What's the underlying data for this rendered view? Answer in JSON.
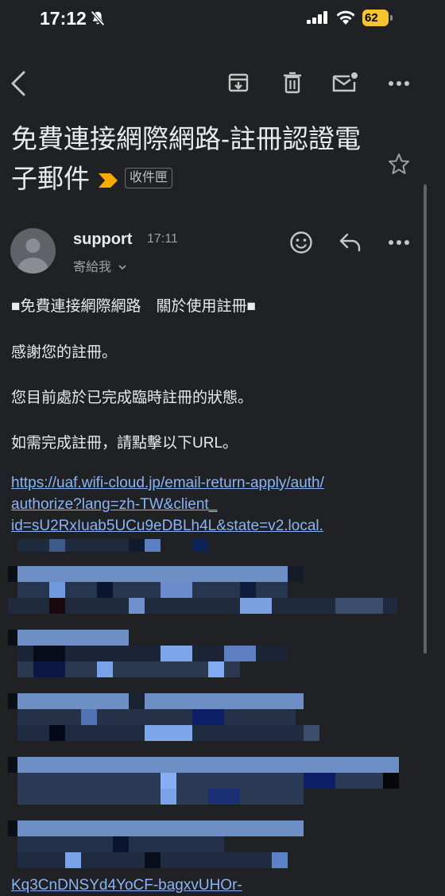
{
  "status_bar": {
    "time": "17:12",
    "battery": "62",
    "icons": [
      "bell-slash-icon",
      "signal-icon",
      "wifi-icon",
      "battery-charging-icon"
    ]
  },
  "toolbar": {
    "icons": [
      "back-icon",
      "archive-icon",
      "trash-icon",
      "mark-unread-icon",
      "more-icon"
    ]
  },
  "email": {
    "subject": "免費連接網際網路-註冊認證電子郵件",
    "label": "收件匣",
    "sender": "support",
    "time": "17:11",
    "to": "寄給我",
    "body": {
      "heading": "■免費連接網際網路　關於使用註冊■",
      "line1": "感謝您的註冊。",
      "line2": "您目前處於已完成臨時註冊的狀態。",
      "line3": "如需完成註冊，請點擊以下URL。",
      "link_line1": "https://uaf.wifi-cloud.jp/email-return-apply/auth/",
      "link_line2": "authorize?lang=zh-TW&client_",
      "link_line3": "id=sU2RxIuab5UCu9eDBLh4L&state=v2.local.",
      "link_last": "Kq3CnDNSYd4YoCF-bagxvUHOr-"
    }
  },
  "colors": {
    "background": "#202124",
    "text": "#e8eaed",
    "link": "#8ab4f8",
    "muted": "#9aa0a6",
    "important_marker": "#f9ab00",
    "battery": "#f4c430"
  }
}
